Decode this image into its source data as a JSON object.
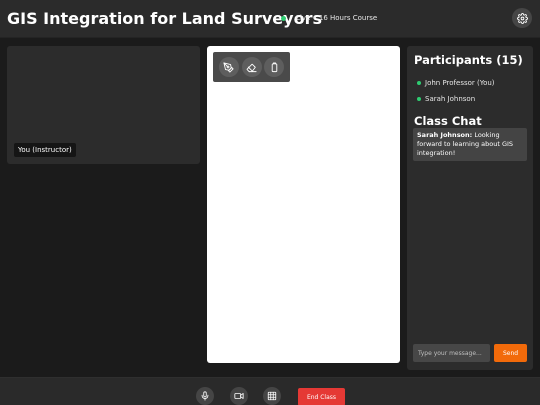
{
  "header": {
    "title": "GIS Integration for Land Surveyors",
    "status": "Live • 16 Hours Course",
    "live_color": "#2ecc71",
    "settings_icon": "gear-icon"
  },
  "video": {
    "label": "You (Instructor)"
  },
  "whiteboard": {
    "tools": [
      "pen-icon",
      "eraser-icon",
      "clear-icon"
    ]
  },
  "sidebar": {
    "participants_title": "Participants (15)",
    "participants": [
      {
        "name": "John Professor (You)"
      },
      {
        "name": "Sarah Johnson"
      }
    ],
    "chat_title": "Class Chat",
    "messages": [
      {
        "author": "Sarah Johnson:",
        "text": "Looking forward to learning about GIS integration!"
      }
    ],
    "input_placeholder": "Type your message...",
    "send_label": "Send"
  },
  "footer": {
    "controls": [
      "microphone-icon",
      "camera-icon",
      "grid-icon"
    ],
    "end_label": "End Class"
  },
  "colors": {
    "accent": "#f26a0a",
    "danger": "#e53935",
    "online": "#2ecc71"
  }
}
